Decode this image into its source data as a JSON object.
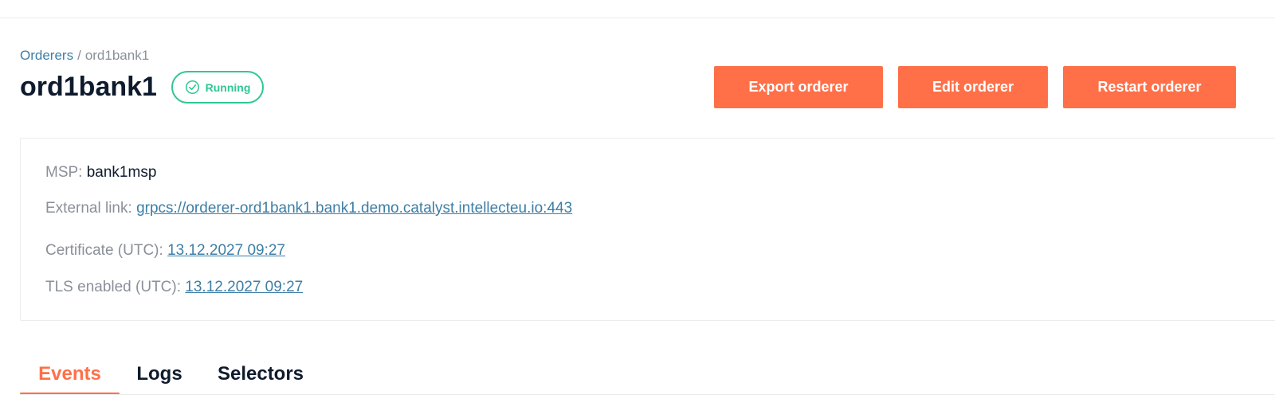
{
  "breadcrumb": {
    "parent_label": "Orderers",
    "separator": "/",
    "current_label": "ord1bank1"
  },
  "header": {
    "title": "ord1bank1",
    "status_label": "Running",
    "status_icon": "check-circle-icon"
  },
  "actions": {
    "export_label": "Export orderer",
    "edit_label": "Edit orderer",
    "restart_label": "Restart orderer"
  },
  "details": {
    "msp_label": "MSP:",
    "msp_value": "bank1msp",
    "external_link_label": "External link:",
    "external_link_value": "grpcs://orderer-ord1bank1.bank1.demo.catalyst.intellecteu.io:443",
    "certificate_label": "Certificate (UTC):",
    "certificate_value": "13.12.2027 09:27",
    "tls_label": "TLS enabled (UTC):",
    "tls_value": "13.12.2027 09:27"
  },
  "tabs": [
    {
      "label": "Events",
      "active": true
    },
    {
      "label": "Logs",
      "active": false
    },
    {
      "label": "Selectors",
      "active": false
    }
  ],
  "colors": {
    "accent": "#ff7048",
    "status": "#2fc796",
    "link": "#3d7ea6",
    "muted_text": "#8a9099",
    "heading_text": "#0f1b2d",
    "divider": "#ececec"
  }
}
